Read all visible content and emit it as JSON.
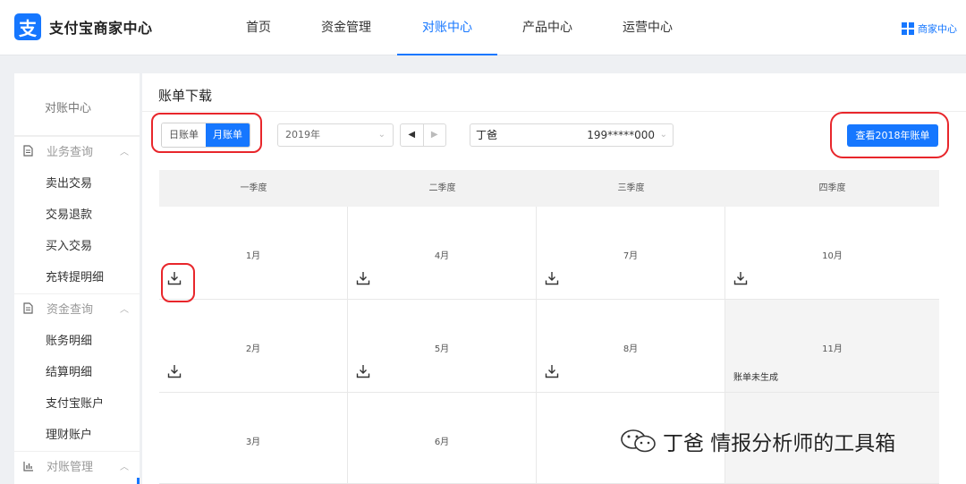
{
  "header": {
    "logo_mark": "支",
    "logo_text": "支付宝商家中心",
    "nav": [
      "首页",
      "资金管理",
      "对账中心",
      "产品中心",
      "运营中心"
    ],
    "active_nav": 2,
    "merchant_link": "商家中心"
  },
  "sidebar": {
    "title": "对账中心",
    "groups": [
      {
        "label": "业务查询",
        "icon": "document-icon",
        "items": [
          "卖出交易",
          "交易退款",
          "买入交易",
          "充转提明细"
        ]
      },
      {
        "label": "资金查询",
        "icon": "document-icon",
        "items": [
          "账务明细",
          "结算明细",
          "支付宝账户",
          "理财账户"
        ]
      },
      {
        "label": "对账管理",
        "icon": "bar-chart-icon",
        "items": []
      }
    ]
  },
  "main": {
    "title": "账单下载",
    "toggle": {
      "day": "日账单",
      "month": "月账单",
      "selected": "month"
    },
    "year_select": {
      "value": "2019年",
      "arrow": "⌄"
    },
    "pager": {
      "prev": "◀",
      "next": "▶"
    },
    "account": {
      "name": "丁爸",
      "number": "199*****000"
    },
    "view_button": "查看2018年账单",
    "quarters": [
      "一季度",
      "二季度",
      "三季度",
      "四季度"
    ],
    "months": [
      [
        {
          "label": "1月",
          "download": true,
          "note": ""
        },
        {
          "label": "4月",
          "download": true,
          "note": ""
        },
        {
          "label": "7月",
          "download": true,
          "note": ""
        },
        {
          "label": "10月",
          "download": true,
          "note": ""
        }
      ],
      [
        {
          "label": "2月",
          "download": true,
          "note": ""
        },
        {
          "label": "5月",
          "download": true,
          "note": ""
        },
        {
          "label": "8月",
          "download": true,
          "note": ""
        },
        {
          "label": "11月",
          "download": false,
          "note": "账单未生成"
        }
      ],
      [
        {
          "label": "3月",
          "download": false,
          "note": ""
        },
        {
          "label": "6月",
          "download": false,
          "note": ""
        },
        {
          "label": "",
          "download": false,
          "note": ""
        },
        {
          "label": "",
          "download": false,
          "note": ""
        }
      ]
    ]
  },
  "watermark": {
    "text": "丁爸 情报分析师的工具箱"
  },
  "colors": {
    "brand": "#1677ff",
    "highlight": "#e8262b"
  }
}
